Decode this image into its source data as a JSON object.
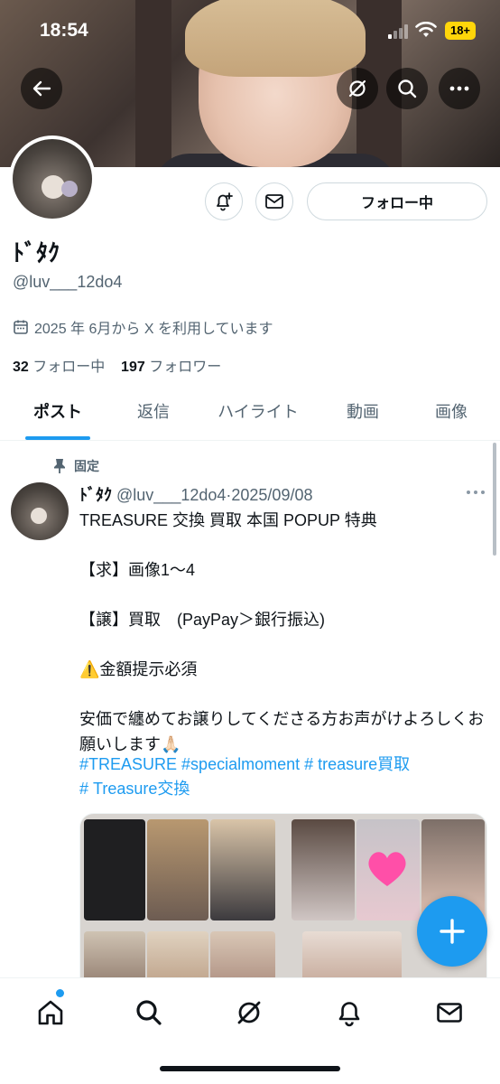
{
  "status_bar": {
    "time": "18:54",
    "battery": "18+"
  },
  "profile": {
    "name": "ﾄﾞﾀｸ",
    "handle": "@luv___12do4",
    "joined": "2025 年 6月から X を利用しています",
    "following_count": "32",
    "following_label": "フォロー中",
    "followers_count": "197",
    "followers_label": "フォロワー",
    "follow_button": "フォロー中"
  },
  "tabs": [
    "ポスト",
    "返信",
    "ハイライト",
    "動画",
    "画像"
  ],
  "pinned_post": {
    "pinned_label": "固定",
    "author_name": "ﾄﾞﾀｸ",
    "author_handle": "@luv___12do4",
    "separator": "·",
    "date": "2025/09/08",
    "body": "TREASURE 交換 買取 本国 POPUP 特典\n\n【求】画像1〜4\n\n【譲】買取　(PayPay＞銀行振込)\n\n⚠️金額提示必須\n\n安価で纏めてお譲りしてくださる方お声がけよろしくお願いします🙏🏻",
    "hashtags": [
      "#TREASURE",
      "#specialmoment",
      "# treasure買取",
      "# Treasure交換"
    ]
  },
  "bottom_nav": [
    "home-icon",
    "search-icon",
    "grok-icon",
    "notifications-icon",
    "messages-icon"
  ],
  "colors": {
    "accent": "#1d9bf0",
    "text": "#0f1419",
    "secondary": "#536471"
  }
}
